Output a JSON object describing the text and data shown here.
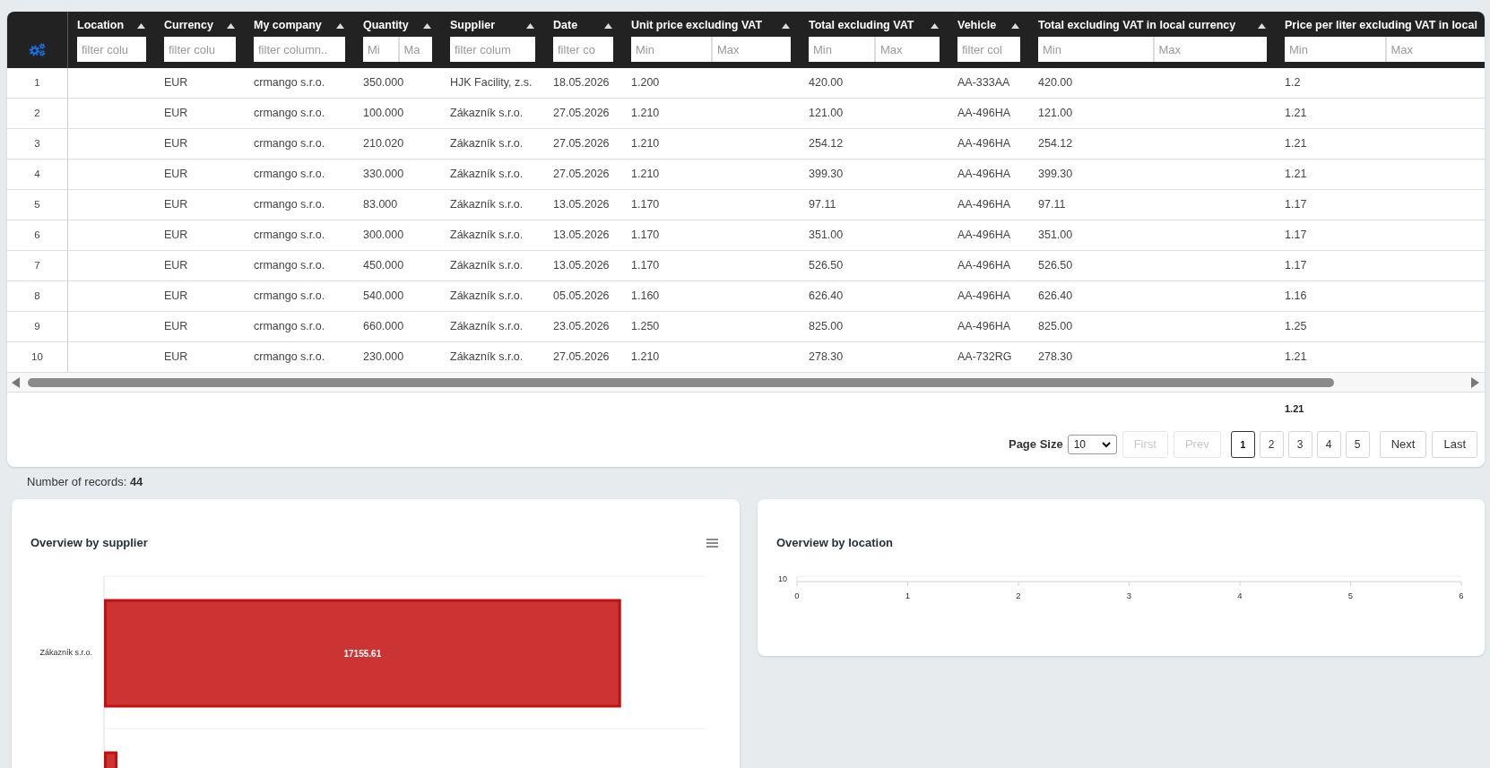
{
  "table": {
    "columns": [
      {
        "label": "Location",
        "sort_arrow": true,
        "filter": {
          "kind": "text",
          "placeholder": "filter colu"
        }
      },
      {
        "label": "Currency",
        "sort_arrow": true,
        "filter": {
          "kind": "text",
          "placeholder": "filter colu"
        }
      },
      {
        "label": "My company",
        "sort_arrow": true,
        "filter": {
          "kind": "text",
          "placeholder": "filter column.."
        }
      },
      {
        "label": "Quantity",
        "sort_arrow": true,
        "filter": {
          "kind": "range",
          "min_placeholder": "Mi",
          "max_placeholder": "Ma"
        }
      },
      {
        "label": "Supplier",
        "sort_arrow": true,
        "filter": {
          "kind": "text",
          "placeholder": "filter colum"
        }
      },
      {
        "label": "Date",
        "sort_arrow": true,
        "filter": {
          "kind": "text",
          "placeholder": "filter co"
        }
      },
      {
        "label": "Unit price excluding VAT",
        "sort_arrow": true,
        "filter": {
          "kind": "range",
          "min_placeholder": "Min",
          "max_placeholder": "Max"
        }
      },
      {
        "label": "Total excluding VAT",
        "sort_arrow": true,
        "filter": {
          "kind": "range",
          "min_placeholder": "Min",
          "max_placeholder": "Max"
        }
      },
      {
        "label": "Vehicle",
        "sort_arrow": true,
        "filter": {
          "kind": "text",
          "placeholder": "filter col"
        }
      },
      {
        "label": "Total excluding VAT in local currency",
        "sort_arrow": true,
        "filter": {
          "kind": "range",
          "min_placeholder": "Min",
          "max_placeholder": "Max"
        }
      },
      {
        "label": "Price per liter excluding VAT in local",
        "sort_arrow": false,
        "filter": {
          "kind": "range",
          "min_placeholder": "Min",
          "max_placeholder": "Max"
        },
        "footer": "1.21"
      }
    ],
    "rows": [
      {
        "number": "1",
        "cells": [
          null,
          "EUR",
          "crmango s.r.o.",
          "350.000",
          "HJK Facility, z.s.",
          "18.05.2026",
          "1.200",
          "420.00",
          "AA-333AA",
          "420.00",
          "1.2"
        ]
      },
      {
        "number": "2",
        "cells": [
          null,
          "EUR",
          "crmango s.r.o.",
          "100.000",
          "Zákazník s.r.o.",
          "27.05.2026",
          "1.210",
          "121.00",
          "AA-496HA",
          "121.00",
          "1.21"
        ]
      },
      {
        "number": "3",
        "cells": [
          null,
          "EUR",
          "crmango s.r.o.",
          "210.020",
          "Zákazník s.r.o.",
          "27.05.2026",
          "1.210",
          "254.12",
          "AA-496HA",
          "254.12",
          "1.21"
        ]
      },
      {
        "number": "4",
        "cells": [
          null,
          "EUR",
          "crmango s.r.o.",
          "330.000",
          "Zákazník s.r.o.",
          "27.05.2026",
          "1.210",
          "399.30",
          "AA-496HA",
          "399.30",
          "1.21"
        ]
      },
      {
        "number": "5",
        "cells": [
          null,
          "EUR",
          "crmango s.r.o.",
          "83.000",
          "Zákazník s.r.o.",
          "13.05.2026",
          "1.170",
          "97.11",
          "AA-496HA",
          "97.11",
          "1.17"
        ]
      },
      {
        "number": "6",
        "cells": [
          null,
          "EUR",
          "crmango s.r.o.",
          "300.000",
          "Zákazník s.r.o.",
          "13.05.2026",
          "1.170",
          "351.00",
          "AA-496HA",
          "351.00",
          "1.17"
        ]
      },
      {
        "number": "7",
        "cells": [
          null,
          "EUR",
          "crmango s.r.o.",
          "450.000",
          "Zákazník s.r.o.",
          "13.05.2026",
          "1.170",
          "526.50",
          "AA-496HA",
          "526.50",
          "1.17"
        ]
      },
      {
        "number": "8",
        "cells": [
          null,
          "EUR",
          "crmango s.r.o.",
          "540.000",
          "Zákazník s.r.o.",
          "05.05.2026",
          "1.160",
          "626.40",
          "AA-496HA",
          "626.40",
          "1.16"
        ]
      },
      {
        "number": "9",
        "cells": [
          null,
          "EUR",
          "crmango s.r.o.",
          "660.000",
          "Zákazník s.r.o.",
          "23.05.2026",
          "1.250",
          "825.00",
          "AA-496HA",
          "825.00",
          "1.25"
        ]
      },
      {
        "number": "10",
        "cells": [
          null,
          "EUR",
          "crmango s.r.o.",
          "230.000",
          "Zákazník s.r.o.",
          "27.05.2026",
          "1.210",
          "278.30",
          "AA-732RG",
          "278.30",
          "1.21"
        ]
      }
    ]
  },
  "pagination": {
    "page_size_label": "Page Size",
    "page_size": "10",
    "buttons": [
      {
        "kind": "nav",
        "label": "First",
        "disabled": true
      },
      {
        "kind": "nav",
        "label": "Prev",
        "disabled": true
      },
      {
        "kind": "page",
        "label": "1",
        "selected": true
      },
      {
        "kind": "page",
        "label": "2",
        "selected": false
      },
      {
        "kind": "page",
        "label": "3",
        "selected": false
      },
      {
        "kind": "page",
        "label": "4",
        "selected": false
      },
      {
        "kind": "page",
        "label": "5",
        "selected": false
      },
      {
        "kind": "nav",
        "label": "Next",
        "disabled": false
      },
      {
        "kind": "nav",
        "label": "Last",
        "disabled": false
      }
    ]
  },
  "records_summary": "Number of records: **44**",
  "charts": [
    {
      "title": "Overview by supplier",
      "has_menu": true,
      "cut_off_bar": true,
      "bars": [
        {
          "category": "Zákazník s.r.o.",
          "value_label": "17155.61"
        }
      ]
    },
    {
      "title": "Overview by location",
      "has_menu": false,
      "cut_off_bar": false,
      "chart_data": {
        "type": "bar",
        "orientation": "horizontal",
        "categories": [
          "10"
        ],
        "series": [
          {
            "values": [
              0
            ]
          }
        ],
        "xlim": [
          0,
          6
        ],
        "xticks": [
          {
            "value": 0,
            "label": "0"
          },
          {
            "value": 1,
            "label": "1"
          },
          {
            "value": 2,
            "label": "2"
          },
          {
            "value": 3,
            "label": "3"
          },
          {
            "value": 4,
            "label": "4"
          },
          {
            "value": 5,
            "label": "5"
          },
          {
            "value": 6,
            "label": "6"
          }
        ]
      }
    }
  ]
}
